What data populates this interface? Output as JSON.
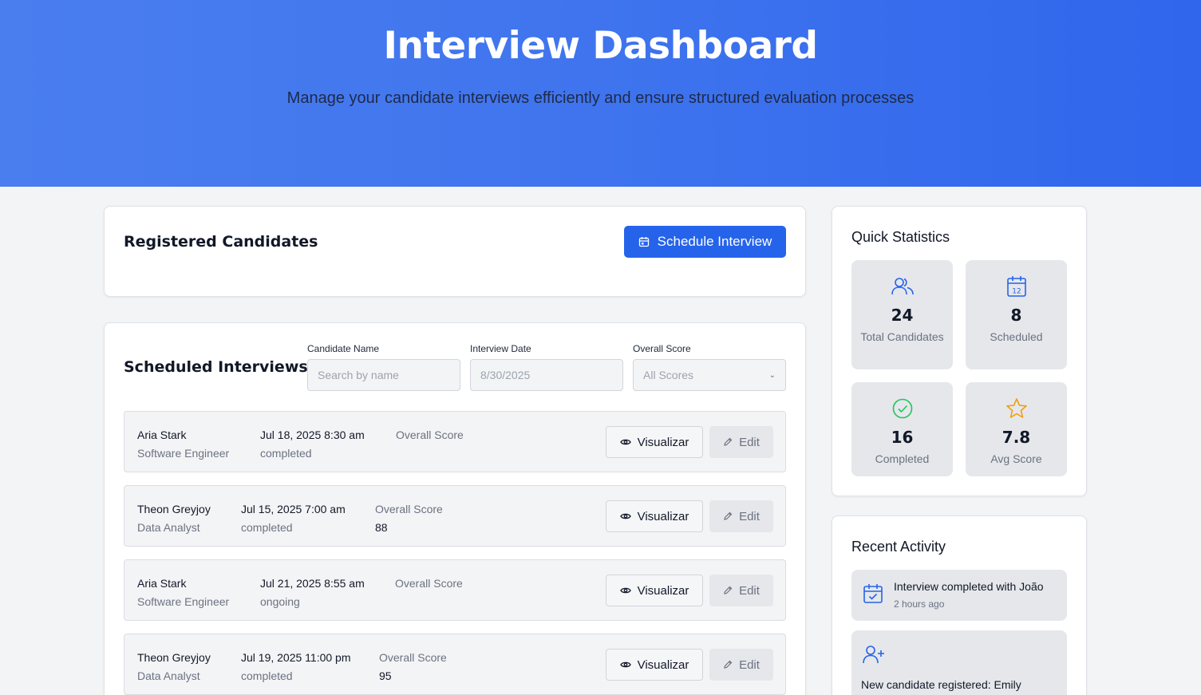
{
  "header": {
    "title": "Interview Dashboard",
    "subtitle": "Manage your candidate interviews efficiently and ensure structured evaluation processes"
  },
  "registered": {
    "title": "Registered Candidates",
    "schedule_button": "Schedule Interview"
  },
  "interviews": {
    "title": "Scheduled Interviews",
    "filters": {
      "name_label": "Candidate Name",
      "name_placeholder": "Search by name",
      "date_label": "Interview Date",
      "date_value": "8/30/2025",
      "score_label": "Overall Score",
      "score_value": "All Scores"
    },
    "score_label": "Overall Score",
    "view_label": "Visualizar",
    "edit_label": "Edit",
    "rows": [
      {
        "name": "Aria Stark",
        "role": "Software Engineer",
        "datetime": "Jul 18, 2025 8:30 am",
        "status": "completed",
        "score": ""
      },
      {
        "name": "Theon Greyjoy",
        "role": "Data Analyst",
        "datetime": "Jul 15, 2025 7:00 am",
        "status": "completed",
        "score": "88"
      },
      {
        "name": "Aria Stark",
        "role": "Software Engineer",
        "datetime": "Jul 21, 2025 8:55 am",
        "status": "ongoing",
        "score": ""
      },
      {
        "name": "Theon Greyjoy",
        "role": "Data Analyst",
        "datetime": "Jul 19, 2025 11:00 pm",
        "status": "completed",
        "score": "95"
      }
    ]
  },
  "stats": {
    "title": "Quick Statistics",
    "items": [
      {
        "icon": "users-icon",
        "value": "24",
        "label": "Total Candidates",
        "color": "#2563eb"
      },
      {
        "icon": "calendar-icon",
        "value": "8",
        "label": "Scheduled",
        "color": "#2563eb"
      },
      {
        "icon": "check-circle-icon",
        "value": "16",
        "label": "Completed",
        "color": "#22c55e"
      },
      {
        "icon": "star-icon",
        "value": "7.8",
        "label": "Avg Score",
        "color": "#f59e0b"
      }
    ]
  },
  "activity": {
    "title": "Recent Activity",
    "items": [
      {
        "icon": "calendar-check-icon",
        "text": "Interview completed with João",
        "time": "2 hours ago"
      },
      {
        "icon": "user-plus-icon",
        "text": "New candidate registered: Emily"
      }
    ]
  }
}
